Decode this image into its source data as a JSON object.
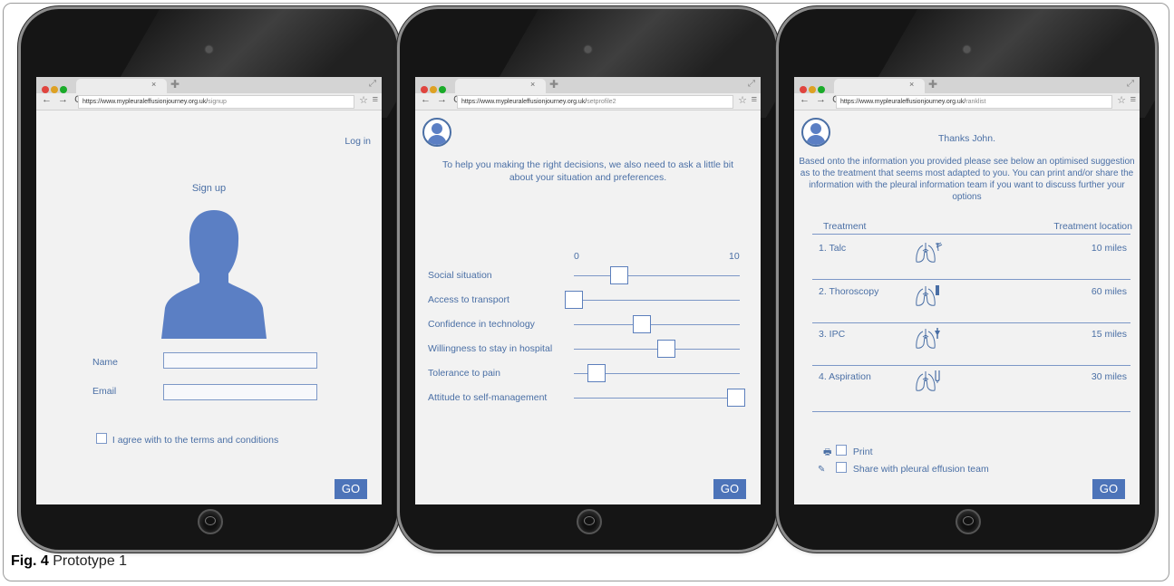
{
  "browser": {
    "url_base": "https://www.mypleuraleffusionjourney.org.uk/",
    "traffic_lights": [
      "#e0443e",
      "#dea123",
      "#1aab29"
    ]
  },
  "screen1": {
    "url_path": "signup",
    "login_link": "Log in",
    "title": "Sign up",
    "name_label": "Name",
    "email_label": "Email",
    "name_value": "",
    "email_value": "",
    "terms_label": "I agree with to the terms and conditions",
    "go_label": "GO"
  },
  "screen2": {
    "url_path": "setprofile2",
    "intro": "To help you making the right decisions, we also need to ask a little bit about your situation and preferences.",
    "scale_min": "0",
    "scale_max": "10",
    "sliders": [
      {
        "label": "Social situation",
        "value": 2.8
      },
      {
        "label": "Access to transport",
        "value": 0
      },
      {
        "label": "Confidence in technology",
        "value": 4.2
      },
      {
        "label": "Willingness to stay in hospital",
        "value": 5.7
      },
      {
        "label": "Tolerance to pain",
        "value": 1.4
      },
      {
        "label": "Attitude to self-management",
        "value": 10
      }
    ],
    "go_label": "GO"
  },
  "screen3": {
    "url_path": "ranklist",
    "greeting": "Thanks John.",
    "intro": "Based onto the information you provided please see below an optimised suggestion as to the treatment that seems most adapted to you.  You can print and/or share the information with the pleural information team if you want to discuss further your options",
    "col_treatment": "Treatment",
    "col_location": "Treatment location",
    "treatments": [
      {
        "name": "1. Talc",
        "distance": "10 miles",
        "icon": "lung-spray-icon"
      },
      {
        "name": "2. Thoroscopy",
        "distance": "60 miles",
        "icon": "lung-scope-icon"
      },
      {
        "name": "3. IPC",
        "distance": "15 miles",
        "icon": "lung-catheter-icon"
      },
      {
        "name": "4. Aspiration",
        "distance": "30 miles",
        "icon": "lung-needle-icon"
      }
    ],
    "print_label": "Print",
    "share_label": "Share with pleural effusion team",
    "go_label": "GO"
  },
  "caption": {
    "fig": "Fig. 4",
    "text": " Prototype 1"
  },
  "colors": {
    "accent": "#4a6fa5",
    "button": "#4d74b9",
    "avatar": "#5b7fc4"
  }
}
